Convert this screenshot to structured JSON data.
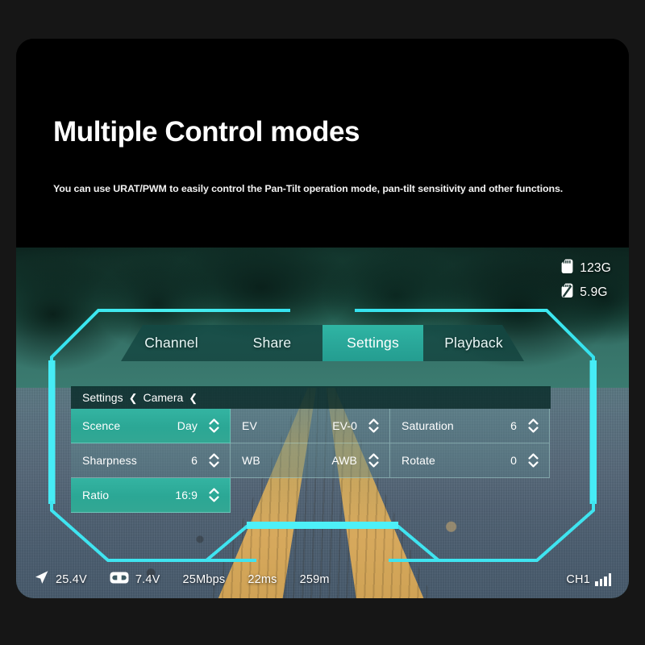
{
  "hero": {
    "title": "Multiple Control modes",
    "subtitle": "You can use URAT/PWM to easily control the Pan-Tilt operation mode, pan-tilt sensitivity and other functions."
  },
  "osd": {
    "storage": [
      {
        "icon": "sd-card-icon",
        "value": "123G"
      },
      {
        "icon": "sd-card-slash-icon",
        "value": "5.9G"
      }
    ],
    "tabs": [
      {
        "label": "Channel",
        "active": false
      },
      {
        "label": "Share",
        "active": false
      },
      {
        "label": "Settings",
        "active": true
      },
      {
        "label": "Playback",
        "active": false
      }
    ],
    "breadcrumb": {
      "root": "Settings",
      "chevron": "❮",
      "current": "Camera",
      "chevron2": "❮"
    },
    "settings_rows": [
      [
        {
          "label": "Scence",
          "value": "Day",
          "highlight": true
        },
        {
          "label": "EV",
          "value": "EV-0",
          "highlight": false
        },
        {
          "label": "Saturation",
          "value": "6",
          "highlight": false
        }
      ],
      [
        {
          "label": "Sharpness",
          "value": "6",
          "highlight": false
        },
        {
          "label": "WB",
          "value": "AWB",
          "highlight": false
        },
        {
          "label": "Rotate",
          "value": "0",
          "highlight": false
        }
      ],
      [
        {
          "label": "Ratio",
          "value": "16:9",
          "highlight": true
        }
      ]
    ],
    "status": {
      "items": [
        {
          "icon": "navigation-arrow-icon",
          "text": "25.4V"
        },
        {
          "icon": "goggles-icon",
          "text": "7.4V"
        },
        {
          "icon": null,
          "text": "25Mbps"
        },
        {
          "icon": null,
          "text": "22ms"
        },
        {
          "icon": null,
          "text": "259m"
        }
      ],
      "channel": "CH1",
      "signal_bars": 4
    },
    "colors": {
      "accent_cyan": "#3fe8f0",
      "tab_active": "#2aa89a",
      "cell_highlight": "#2ba795",
      "panel_fill": "#5c8890",
      "text": "#ffffff"
    }
  }
}
